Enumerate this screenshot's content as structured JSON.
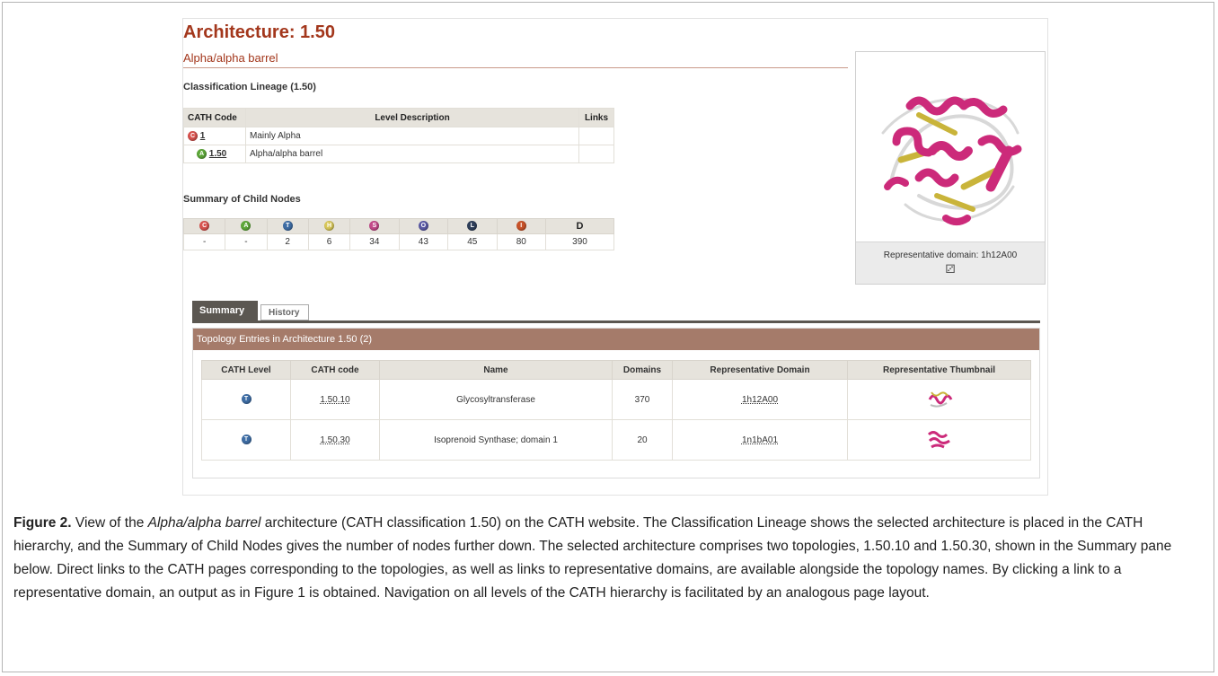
{
  "architecture": {
    "title": "Architecture: 1.50",
    "subtitle": "Alpha/alpha barrel"
  },
  "lineage": {
    "heading": "Classification Lineage (1.50)",
    "headers": [
      "CATH Code",
      "Level Description",
      "Links"
    ],
    "rows": [
      {
        "icon": "C",
        "code": "1",
        "description": "Mainly Alpha"
      },
      {
        "icon": "A",
        "code": "1.50",
        "description": "Alpha/alpha barrel"
      }
    ]
  },
  "child_nodes": {
    "heading": "Summary of Child Nodes",
    "levels": [
      "C",
      "A",
      "T",
      "H",
      "S",
      "O",
      "L",
      "I",
      "D"
    ],
    "values": [
      "-",
      "-",
      "2",
      "6",
      "34",
      "43",
      "45",
      "80",
      "390"
    ]
  },
  "representative": {
    "label": "Representative domain: 1h12A00",
    "icon": "molecule-icon",
    "colors": {
      "helix": "#cc2a7a",
      "sheet": "#c9b43a",
      "loop": "#d8d8d8"
    }
  },
  "tabs": [
    {
      "label": "Summary",
      "active": true
    },
    {
      "label": "History",
      "active": false
    }
  ],
  "topology": {
    "heading": "Topology Entries in Architecture 1.50 (2)",
    "headers": [
      "CATH Level",
      "CATH code",
      "Name",
      "Domains",
      "Representative Domain",
      "Representative Thumbnail"
    ],
    "rows": [
      {
        "level": "T",
        "code": "1.50.10",
        "name": "Glycosyltransferase",
        "domains": "370",
        "rep": "1h12A00"
      },
      {
        "level": "T",
        "code": "1.50.30",
        "name": "Isoprenoid Synthase; domain 1",
        "domains": "20",
        "rep": "1n1bA01"
      }
    ]
  },
  "caption": {
    "label": "Figure 2.",
    "p1": "View of the",
    "em1": "Alpha/alpha barrel",
    "p2": "architecture (CATH classification 1.50) on the CATH website. The Classification Lineage shows the selected architecture is placed in the CATH hierarchy, and the Summary of Child Nodes gives the number of nodes further down. The selected architecture comprises two topologies, 1.50.10 and 1.50.30, shown in the Summary pane below. Direct links to the CATH pages corresponding to the topologies, as well as links to representative domains, are available alongside the topology names. By clicking a link to a representative domain, an output as in Figure 1 is obtained. Navigation on all levels of the CATH hierarchy is facilitated by an analogous page layout."
  },
  "accent": "#a3371c"
}
